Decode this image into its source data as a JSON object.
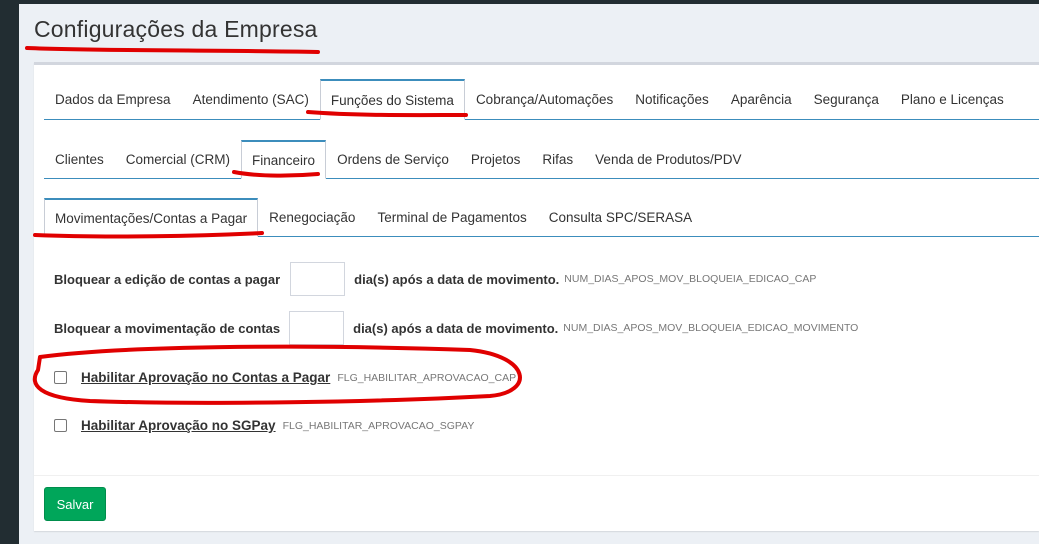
{
  "page": {
    "title": "Configurações da Empresa"
  },
  "tabs_l1": [
    {
      "label": "Dados da Empresa",
      "active": false
    },
    {
      "label": "Atendimento (SAC)",
      "active": false
    },
    {
      "label": "Funções do Sistema",
      "active": true
    },
    {
      "label": "Cobrança/Automações",
      "active": false
    },
    {
      "label": "Notificações",
      "active": false
    },
    {
      "label": "Aparência",
      "active": false
    },
    {
      "label": "Segurança",
      "active": false
    },
    {
      "label": "Plano e Licenças",
      "active": false
    }
  ],
  "tabs_l2": [
    {
      "label": "Clientes",
      "active": false
    },
    {
      "label": "Comercial (CRM)",
      "active": false
    },
    {
      "label": "Financeiro",
      "active": true
    },
    {
      "label": "Ordens de Serviço",
      "active": false
    },
    {
      "label": "Projetos",
      "active": false
    },
    {
      "label": "Rifas",
      "active": false
    },
    {
      "label": "Venda de Produtos/PDV",
      "active": false
    }
  ],
  "tabs_l3": [
    {
      "label": "Movimentações/Contas a Pagar",
      "active": true
    },
    {
      "label": "Renegociação",
      "active": false
    },
    {
      "label": "Terminal de Pagamentos",
      "active": false
    },
    {
      "label": "Consulta SPC/SERASA",
      "active": false
    }
  ],
  "fields": {
    "bloqueio_edicao": {
      "label": "Bloquear a edição de contas a pagar",
      "value": "",
      "suffix": "dia(s) após a data de movimento.",
      "key": "NUM_DIAS_APOS_MOV_BLOQUEIA_EDICAO_CAP"
    },
    "bloqueio_movimentacao": {
      "label": "Bloquear a movimentação de contas",
      "value": "",
      "suffix": "dia(s) após a data de movimento.",
      "key": "NUM_DIAS_APOS_MOV_BLOQUEIA_EDICAO_MOVIMENTO"
    },
    "aprovacao_cap": {
      "label": "Habilitar Aprovação no Contas a Pagar",
      "checked": false,
      "key": "FLG_HABILITAR_APROVACAO_CAP"
    },
    "aprovacao_sgpay": {
      "label": "Habilitar Aprovação no SGPay",
      "checked": false,
      "key": "FLG_HABILITAR_APROVACAO_SGPAY"
    }
  },
  "buttons": {
    "save_label": "Salvar"
  },
  "colors": {
    "accent": "#3c8dbc",
    "save_button": "#00a65a",
    "annotation": "#e00000",
    "sidebar": "#222d32"
  }
}
